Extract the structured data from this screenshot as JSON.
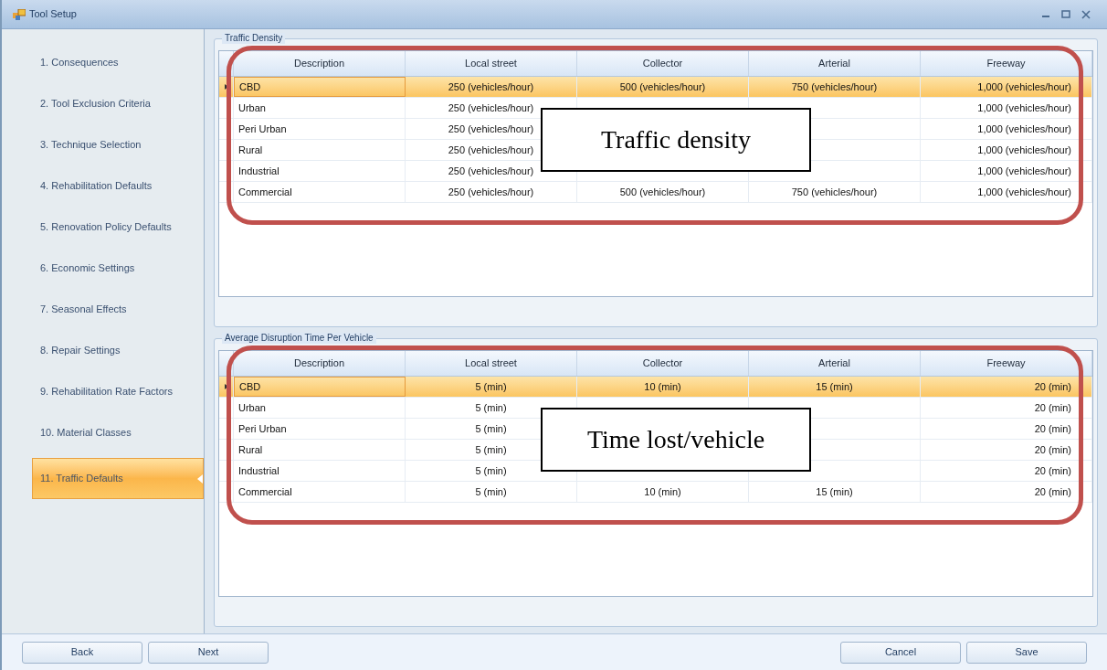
{
  "window": {
    "title": "Tool Setup"
  },
  "sidebar": {
    "items": [
      {
        "label": "1. Consequences",
        "selected": false
      },
      {
        "label": "2. Tool Exclusion Criteria",
        "selected": false
      },
      {
        "label": "3. Technique Selection",
        "selected": false
      },
      {
        "label": "4. Rehabilitation Defaults",
        "selected": false
      },
      {
        "label": "5. Renovation Policy Defaults",
        "selected": false
      },
      {
        "label": "6. Economic Settings",
        "selected": false
      },
      {
        "label": "7. Seasonal Effects",
        "selected": false
      },
      {
        "label": "8. Repair Settings",
        "selected": false
      },
      {
        "label": "9. Rehabilitation Rate Factors",
        "selected": false
      },
      {
        "label": "10. Material Classes",
        "selected": false
      },
      {
        "label": "11. Traffic Defaults",
        "selected": true
      }
    ]
  },
  "sections": [
    {
      "title": "Traffic Density",
      "callout": "Traffic density",
      "columns": [
        "Description",
        "Local street",
        "Collector",
        "Arterial",
        "Freeway"
      ],
      "rows": [
        {
          "selected": true,
          "cells": [
            "CBD",
            "250 (vehicles/hour)",
            "500 (vehicles/hour)",
            "750 (vehicles/hour)",
            "1,000 (vehicles/hour)"
          ]
        },
        {
          "selected": false,
          "cells": [
            "Urban",
            "250 (vehicles/hour)",
            null,
            null,
            "1,000 (vehicles/hour)"
          ]
        },
        {
          "selected": false,
          "cells": [
            "Peri Urban",
            "250 (vehicles/hour)",
            null,
            null,
            "1,000 (vehicles/hour)"
          ]
        },
        {
          "selected": false,
          "cells": [
            "Rural",
            "250 (vehicles/hour)",
            null,
            null,
            "1,000 (vehicles/hour)"
          ]
        },
        {
          "selected": false,
          "cells": [
            "Industrial",
            "250 (vehicles/hour)",
            null,
            null,
            "1,000 (vehicles/hour)"
          ]
        },
        {
          "selected": false,
          "cells": [
            "Commercial",
            "250 (vehicles/hour)",
            "500 (vehicles/hour)",
            "750 (vehicles/hour)",
            "1,000 (vehicles/hour)"
          ]
        }
      ]
    },
    {
      "title": "Average Disruption Time Per Vehicle",
      "callout": "Time lost/vehicle",
      "columns": [
        "Description",
        "Local street",
        "Collector",
        "Arterial",
        "Freeway"
      ],
      "rows": [
        {
          "selected": true,
          "cells": [
            "CBD",
            "5 (min)",
            "10 (min)",
            "15 (min)",
            "20 (min)"
          ]
        },
        {
          "selected": false,
          "cells": [
            "Urban",
            "5 (min)",
            null,
            null,
            "20 (min)"
          ]
        },
        {
          "selected": false,
          "cells": [
            "Peri Urban",
            "5 (min)",
            null,
            null,
            "20 (min)"
          ]
        },
        {
          "selected": false,
          "cells": [
            "Rural",
            "5 (min)",
            null,
            null,
            "20 (min)"
          ]
        },
        {
          "selected": false,
          "cells": [
            "Industrial",
            "5 (min)",
            null,
            null,
            "20 (min)"
          ]
        },
        {
          "selected": false,
          "cells": [
            "Commercial",
            "5 (min)",
            "10 (min)",
            "15 (min)",
            "20 (min)"
          ]
        }
      ]
    }
  ],
  "buttons_left": [
    "Back",
    "Next"
  ],
  "buttons_right": [
    "Cancel",
    "Save"
  ]
}
